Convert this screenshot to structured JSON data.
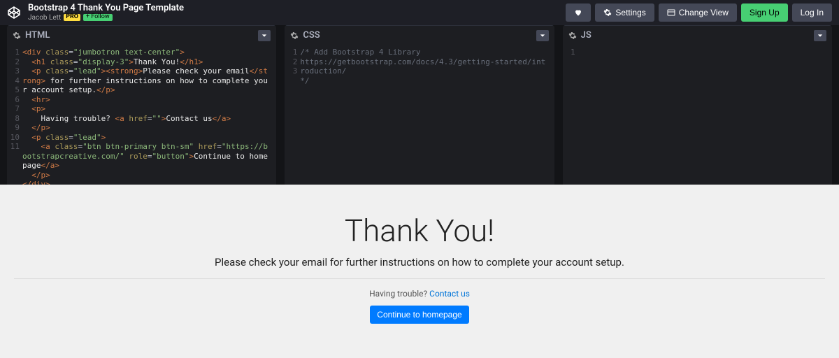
{
  "header": {
    "title": "Bootstrap 4 Thank You Page Template",
    "author": "Jacob Lett",
    "pro": "PRO",
    "follow": "+ Follow",
    "buttons": {
      "settings": "Settings",
      "changeView": "Change View",
      "signUp": "Sign Up",
      "logIn": "Log In"
    }
  },
  "editors": {
    "html": {
      "title": "HTML"
    },
    "css": {
      "title": "CSS"
    },
    "js": {
      "title": "JS"
    }
  },
  "html_code": {
    "l1_cls": "jumbotron text-center",
    "l2_cls": "display-3",
    "l2_txt": "Thank You!",
    "l3_cls": "lead",
    "l3_txt1": "Please check your email",
    "l3_txt2": " for further instructions on how to complete your account setup.",
    "l6_txt": "    Having trouble? ",
    "l6_href": "",
    "l6_link": "Contact us",
    "l8_cls": "lead",
    "l9_cls": "btn btn-primary btn-sm",
    "l9_href": "https://bootstrapcreative.com/",
    "l9_role": "button",
    "l9_txt": "Continue to homepage"
  },
  "css_code": {
    "l1": "/* Add Bootstrap 4 Library",
    "l2": "https://getbootstrap.com/docs/4.3/getting-started/introduction/",
    "l3": "*/"
  },
  "gutter": {
    "html": [
      "1",
      "2",
      "3",
      "4",
      "5",
      "6",
      "7",
      "8",
      "9",
      "10",
      "11"
    ],
    "css": [
      "1",
      "2",
      "3"
    ],
    "js": [
      "1"
    ]
  },
  "preview": {
    "h1": "Thank You!",
    "lead": "Please check your email for further instructions on how to complete your account setup.",
    "trouble": "Having trouble? ",
    "contact": "Contact us",
    "cta": "Continue to homepage"
  }
}
